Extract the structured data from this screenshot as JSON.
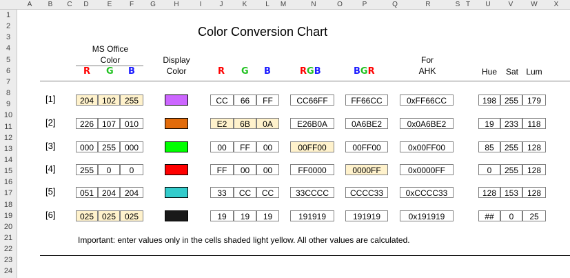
{
  "sheet": {
    "columns": [
      "A",
      "B",
      "C",
      "D",
      "E",
      "F",
      "G",
      "H",
      "I",
      "J",
      "K",
      "L",
      "M",
      "N",
      "O",
      "P",
      "Q",
      "R",
      "S",
      "T",
      "U",
      "V",
      "W",
      "X"
    ],
    "rows": [
      "1",
      "2",
      "3",
      "4",
      "5",
      "6",
      "7",
      "8",
      "9",
      "10",
      "11",
      "12",
      "13",
      "14",
      "15",
      "16",
      "17",
      "18",
      "19",
      "20",
      "21",
      "22",
      "23",
      "24"
    ]
  },
  "chart": {
    "title": "Color Conversion Chart",
    "ms_office_line1": "MS Office",
    "ms_office_line2": "Color",
    "display_line1": "Display",
    "display_line2": "Color",
    "for_line1": "For",
    "for_line2": "AHK",
    "letter_r": "R",
    "letter_g": "G",
    "letter_b": "B",
    "hue": "Hue",
    "sat": "Sat",
    "lum": "Lum",
    "note": "Important: enter values only in the cells shaded light yellow. All other values are calculated."
  },
  "rows": [
    {
      "label": "[1]",
      "dec": [
        "204",
        "102",
        "255"
      ],
      "swatch": "#cc66ff",
      "hex": [
        "CC",
        "66",
        "FF"
      ],
      "rgb": "CC66FF",
      "bgr": "FF66CC",
      "ahk": "0xFF66CC",
      "hsl": [
        "198",
        "255",
        "179"
      ]
    },
    {
      "label": "[2]",
      "dec": [
        "226",
        "107",
        "010"
      ],
      "swatch": "#e26b0a",
      "hex": [
        "E2",
        "6B",
        "0A"
      ],
      "rgb": "E26B0A",
      "bgr": "0A6BE2",
      "ahk": "0x0A6BE2",
      "hsl": [
        "19",
        "233",
        "118"
      ]
    },
    {
      "label": "[3]",
      "dec": [
        "000",
        "255",
        "000"
      ],
      "swatch": "#00ff00",
      "hex": [
        "00",
        "FF",
        "00"
      ],
      "rgb": "00FF00",
      "bgr": "00FF00",
      "ahk": "0x00FF00",
      "hsl": [
        "85",
        "255",
        "128"
      ]
    },
    {
      "label": "[4]",
      "dec": [
        "255",
        "0",
        "0"
      ],
      "swatch": "#ff0000",
      "hex": [
        "FF",
        "00",
        "00"
      ],
      "rgb": "FF0000",
      "bgr": "0000FF",
      "ahk": "0x0000FF",
      "hsl": [
        "0",
        "255",
        "128"
      ]
    },
    {
      "label": "[5]",
      "dec": [
        "051",
        "204",
        "204"
      ],
      "swatch": "#33cccc",
      "hex": [
        "33",
        "CC",
        "CC"
      ],
      "rgb": "33CCCC",
      "bgr": "CCCC33",
      "ahk": "0xCCCC33",
      "hsl": [
        "128",
        "153",
        "128"
      ]
    },
    {
      "label": "[6]",
      "dec": [
        "025",
        "025",
        "025"
      ],
      "swatch": "#191919",
      "hex": [
        "19",
        "19",
        "19"
      ],
      "rgb": "191919",
      "bgr": "191919",
      "ahk": "0x191919",
      "hsl": [
        "##",
        "0",
        "25"
      ]
    }
  ]
}
